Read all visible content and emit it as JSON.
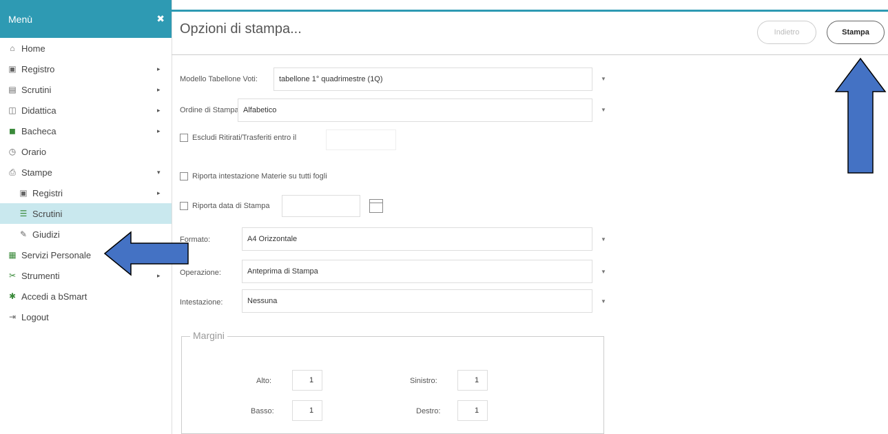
{
  "sidebar": {
    "header": "Menù",
    "close": "✖",
    "items": [
      {
        "label": "Home",
        "icon": "home-icon",
        "glyph": "⌂"
      },
      {
        "label": "Registro",
        "icon": "calendar-icon",
        "glyph": "▣",
        "caret": "▸"
      },
      {
        "label": "Scrutini",
        "icon": "document-icon",
        "glyph": "▤",
        "caret": "▸"
      },
      {
        "label": "Didattica",
        "icon": "book-icon",
        "glyph": "◫",
        "caret": "▸"
      },
      {
        "label": "Bacheca",
        "icon": "board-icon",
        "glyph": "◼",
        "caret": "▸"
      },
      {
        "label": "Orario",
        "icon": "clock-icon",
        "glyph": "◷"
      },
      {
        "label": "Stampe",
        "icon": "printer-icon",
        "glyph": "⎙",
        "caret": "▾"
      },
      {
        "label": "Registri",
        "icon": "calendar-icon",
        "glyph": "▣",
        "caret": "▸"
      },
      {
        "label": "Scrutini",
        "icon": "list-icon",
        "glyph": "☰"
      },
      {
        "label": "Giudizi",
        "icon": "edit-icon",
        "glyph": "✎"
      },
      {
        "label": "Servizi Personale",
        "icon": "folder-icon",
        "glyph": "▦"
      },
      {
        "label": "Strumenti",
        "icon": "tools-icon",
        "glyph": "✂",
        "caret": "▸"
      },
      {
        "label": "Accedi a bSmart",
        "icon": "star-icon",
        "glyph": "✱"
      },
      {
        "label": "Logout",
        "icon": "logout-icon",
        "glyph": "⇥"
      }
    ]
  },
  "header": {
    "title": "Opzioni di stampa...",
    "back_label": "Indietro",
    "print_label": "Stampa"
  },
  "form": {
    "modello_label": "Modello Tabellone Voti:",
    "modello_value": "tabellone 1° quadrimestre (1Q)",
    "ordine_label": "Ordine di Stampa:",
    "ordine_value": "Alfabetico",
    "escludi_label": "Escludi Ritirati/Trasferiti entro il",
    "riporta_int_label": "Riporta intestazione Materie su tutti fogli",
    "riporta_data_label": "Riporta data di Stampa",
    "formato_label": "Formato:",
    "formato_value": "A4 Orizzontale",
    "operazione_label": "Operazione:",
    "operazione_value": "Anteprima di Stampa",
    "intestazione_label": "Intestazione:",
    "intestazione_value": "Nessuna",
    "dropdown_glyph": "▼"
  },
  "margini": {
    "legend": "Margini",
    "alto_label": "Alto:",
    "alto_value": "1",
    "basso_label": "Basso:",
    "basso_value": "1",
    "sinistro_label": "Sinistro:",
    "sinistro_value": "1",
    "destro_label": "Destro:",
    "destro_value": "1"
  },
  "colors": {
    "accent": "#2e9ab3",
    "active_item": "#c9e8ee",
    "arrow_fill": "#4472c4"
  }
}
